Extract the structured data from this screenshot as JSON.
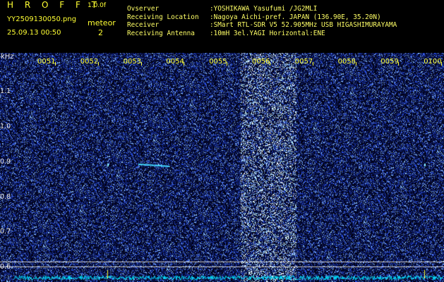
{
  "header": {
    "brand": "H R O F F T",
    "version": "1.0.0f",
    "file_name": "YY2509130050.png",
    "datetime": "25.09.13 00:50",
    "meteor_label": "meteor",
    "meteor_count": "2"
  },
  "info": [
    {
      "key": "Ovserver",
      "value": ":YOSHIKAWA Yasufumi /JG2MLI"
    },
    {
      "key": "Receiving Location",
      "value": ":Nagoya Aichi-pref. JAPAN (136.90E, 35.20N)"
    },
    {
      "key": "Receiver",
      "value": ":SMart RTL-SDR V5 52.905MHz USB HIGASHIMURAYAMA"
    },
    {
      "key": "Receiving Antenna",
      "value": ":10mH 3el.YAGI Horizontal:ENE"
    }
  ],
  "axis": {
    "unit": "kHz",
    "freq_labels": [
      "1.1",
      "1.0",
      "0.9",
      "0.8",
      "0.7",
      "0.6"
    ],
    "time_labels": [
      "0051",
      "0052",
      "0053",
      "0054",
      "0055",
      "0056",
      "0057",
      "0058",
      "0059",
      "0100"
    ]
  },
  "colors": {
    "header_text": "#ffff33",
    "background": "#000000",
    "spectrum_noise": "#1a1aff",
    "signal_trace": "#00e5ff"
  }
}
